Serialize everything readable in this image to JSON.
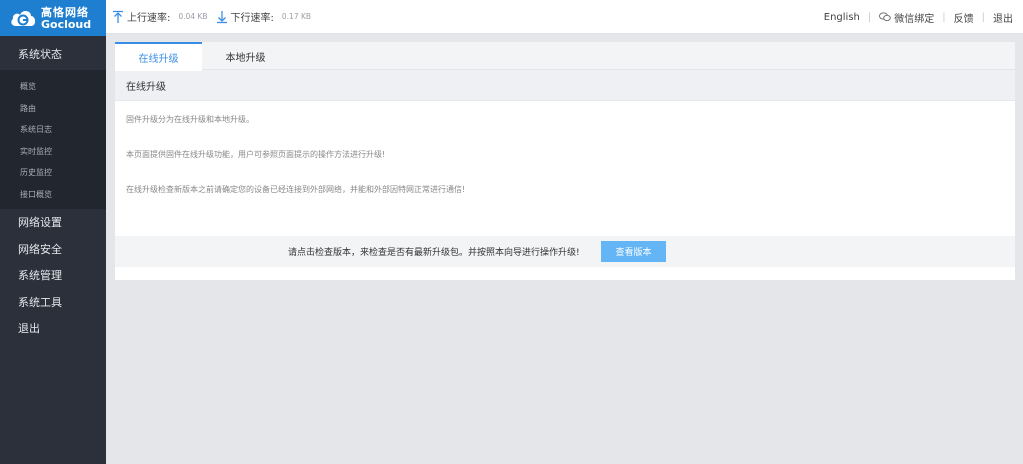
{
  "brand": {
    "name_cn": "高恪网络",
    "name_en": "Gocloud"
  },
  "sidebar": {
    "status": {
      "label": "系统状态"
    },
    "status_items": [
      {
        "label": "概览"
      },
      {
        "label": "路由"
      },
      {
        "label": "系统日志"
      },
      {
        "label": "实时监控"
      },
      {
        "label": "历史监控"
      },
      {
        "label": "接口概览"
      }
    ],
    "menu": [
      {
        "label": "网络设置"
      },
      {
        "label": "网络安全"
      },
      {
        "label": "系统管理"
      },
      {
        "label": "系统工具"
      },
      {
        "label": "退出"
      }
    ]
  },
  "topbar": {
    "upload_label": "上行速率:",
    "upload_value": "0.04 KB",
    "download_label": "下行速率:",
    "download_value": "0.17 KB",
    "english": "English",
    "wechat": "微信绑定",
    "feedback": "反馈",
    "logout": "退出"
  },
  "tabs": [
    {
      "label": "在线升级",
      "active": true
    },
    {
      "label": "本地升级",
      "active": false
    }
  ],
  "section": {
    "title": "在线升级"
  },
  "content": {
    "p1": "固件升级分为在线升级和本地升级。",
    "p2": "本页面提供固件在线升级功能，用户可参照页面提示的操作方法进行升级!",
    "p3": "在线升级检查新版本之前请确定您的设备已经连接到外部网络，并能和外部因特网正常进行通信!"
  },
  "footer": {
    "hint": "请点击检查版本，来检查是否有最新升级包。并按照本向导进行操作升级!",
    "button": "查看版本"
  },
  "colors": {
    "accent": "#3a8ee6",
    "sidebar": "#2b303b",
    "logo_bg": "#1e7fd0",
    "button": "#64b5f6"
  }
}
